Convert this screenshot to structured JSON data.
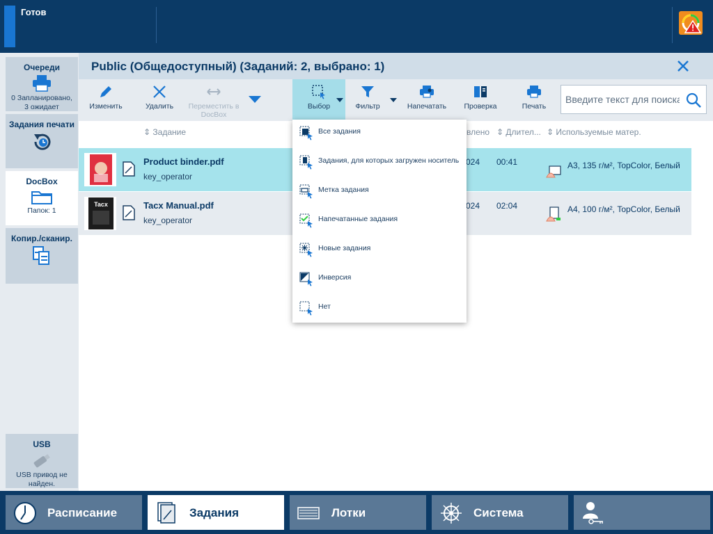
{
  "status": {
    "text": "Готов"
  },
  "colors": {
    "navy": "#0b3a66",
    "accent": "#1976d2",
    "selected_row": "#a5e3ec",
    "panel": "#e6ebf0",
    "warning": "#f08c1e"
  },
  "sidebar": {
    "queues": {
      "title": "Очереди",
      "sub1": "0 Запланировано,",
      "sub2": "3 ожидает"
    },
    "print_jobs": {
      "title": "Задания печати"
    },
    "docbox": {
      "title": "DocBox",
      "sub": "Папок: 1"
    },
    "copy_scan": {
      "title": "Копир./сканир."
    },
    "usb": {
      "title": "USB",
      "sub1": "USB привод не",
      "sub2": "найден."
    }
  },
  "main": {
    "title": "Public (Общедоступный) (Заданий: 2, выбрано: 1)"
  },
  "toolbar": {
    "edit": "Изменить",
    "delete": "Удалить",
    "move1": "Переместить в",
    "move2": "DocBox",
    "select": "Выбор",
    "filter": "Фильтр",
    "print_label": "Напечатать",
    "proof": "Проверка",
    "print": "Печать",
    "search_placeholder": "Введите текст для поиска"
  },
  "columns": {
    "job": "Задание",
    "added": "влено",
    "duration": "Длител...",
    "media": "Используемые матер."
  },
  "jobs": [
    {
      "name": "Product binder.pdf",
      "owner": "key_operator",
      "date": "024",
      "duration": "00:41",
      "media": "A3, 135 г/м², TopColor, Белый"
    },
    {
      "name": "Tacx Manual.pdf",
      "owner": "key_operator",
      "date": "024",
      "duration": "02:04",
      "media": "A4, 100 г/м², TopColor, Белый"
    }
  ],
  "thumb_text": {
    "tacx": "Tacx"
  },
  "dropdown": {
    "items": [
      {
        "label": "Все задания",
        "icon": "select-all-icon"
      },
      {
        "label": "Задания, для которых загружен носитель",
        "icon": "select-loaded-media-icon"
      },
      {
        "label": "Метка задания",
        "icon": "job-label-icon"
      },
      {
        "label": "Напечатанные задания",
        "icon": "printed-jobs-icon"
      },
      {
        "label": "Новые задания",
        "icon": "new-jobs-icon"
      },
      {
        "label": "Инверсия",
        "icon": "invert-icon"
      },
      {
        "label": "Нет",
        "icon": "select-none-icon"
      }
    ]
  },
  "bottom_nav": {
    "schedule": "Расписание",
    "jobs": "Задания",
    "trays": "Лотки",
    "system": "Система"
  }
}
